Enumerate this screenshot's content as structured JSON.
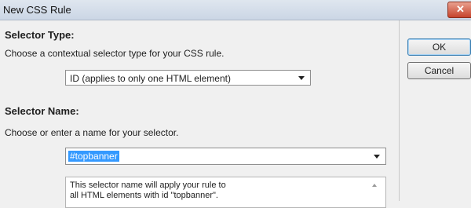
{
  "window": {
    "title": "New CSS Rule"
  },
  "selector_type": {
    "heading": "Selector Type:",
    "description": "Choose a contextual selector type for your CSS rule.",
    "selected": "ID (applies to only one HTML element)"
  },
  "selector_name": {
    "heading": "Selector Name:",
    "description": "Choose or enter a name for your selector.",
    "value": "#topbanner",
    "info_text": "This selector name will apply your rule to\nall HTML elements with id \"topbanner\"."
  },
  "buttons": {
    "ok": "OK",
    "cancel": "Cancel"
  },
  "icons": {
    "close": "close-icon",
    "dropdown": "chevron-down-icon",
    "scroll": "scroll-up-arrow-icon"
  }
}
